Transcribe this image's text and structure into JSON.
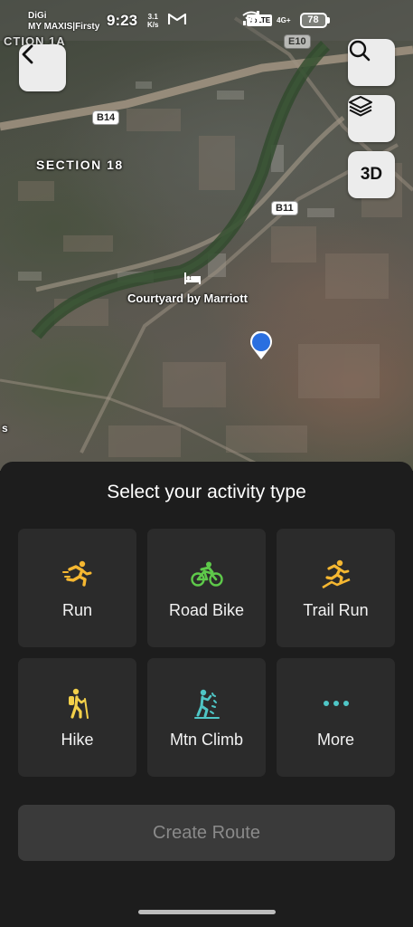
{
  "status_bar": {
    "carrier1": "DiGi",
    "carrier2": "MY MAXIS|Firsty",
    "time": "9:23",
    "speed_value": "3.1",
    "speed_unit": "K/s",
    "volte": "VoLTE",
    "network": "4G+",
    "battery": "78"
  },
  "map": {
    "labels": {
      "section_top": "CTION 1A",
      "section_18": "SECTION 18",
      "poi": "Courtyard by Marriott",
      "edge": "s"
    },
    "roads": {
      "e10": "E10",
      "b14": "B14",
      "b11": "B11"
    },
    "buttons": {
      "three_d": "3D"
    }
  },
  "panel": {
    "title": "Select your activity type",
    "activities": [
      {
        "label": "Run",
        "icon": "run-icon",
        "color": "#f5b731"
      },
      {
        "label": "Road Bike",
        "icon": "road-bike-icon",
        "color": "#5ec94a"
      },
      {
        "label": "Trail Run",
        "icon": "trail-run-icon",
        "color": "#f5b731"
      },
      {
        "label": "Hike",
        "icon": "hike-icon",
        "color": "#f3d04a"
      },
      {
        "label": "Mtn Climb",
        "icon": "mountain-climb-icon",
        "color": "#4fc6c6"
      },
      {
        "label": "More",
        "icon": "more-dots-icon",
        "color": "#4fc6c6"
      }
    ],
    "create_route": "Create Route"
  }
}
